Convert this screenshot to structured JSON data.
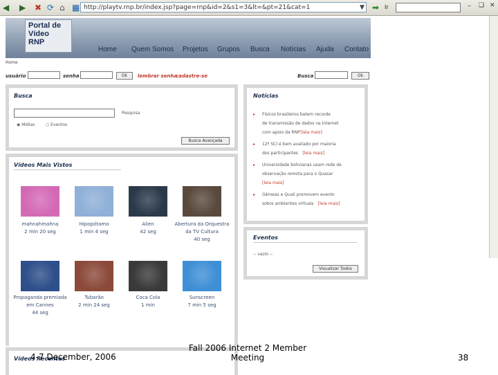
{
  "browser": {
    "address": "http://playtv.rnp.br/index.jsp?page=rnp&id=2&s1=3&lt=&pt=21&cat=1",
    "go_label": "Ir"
  },
  "site": {
    "logo": [
      "Portal de",
      "Vídeo",
      "RNP"
    ],
    "nav": [
      "Home",
      "Quem Somos",
      "Projetos",
      "Grupos",
      "Busca",
      "Notícias",
      "Ajuda",
      "Contato"
    ],
    "breadcrumb": "Home"
  },
  "login": {
    "user_label": "usuário",
    "pass_label": "senha",
    "ok_label": "Ok",
    "forgot_label": "lembrar senha",
    "register_label": "cadastre-se",
    "search_label": "Busca",
    "search_ok": "Ok"
  },
  "busca": {
    "title": "Busca",
    "button": "Pesquisa",
    "options": [
      "Mídias",
      "Eventos"
    ],
    "advanced": "Busca Avançada"
  },
  "videos": {
    "title": "Vídeos Mais Vistos",
    "items": [
      {
        "name": "mahnahmahna",
        "duration": "2 min 20 seg",
        "color": "#d46ab5"
      },
      {
        "name": "Hipopótamo",
        "duration": "1 min 4 seg",
        "color": "#8fb0d8"
      },
      {
        "name": "Alien",
        "duration": "42 seg",
        "color": "#2b3a4a"
      },
      {
        "name": "Abertura da Orquestra da TV Cultura",
        "duration": "40 seg",
        "color": "#5a4a3e"
      },
      {
        "name": "Propaganda premiada em Cannes",
        "duration": "44 seg",
        "color": "#2e4f8a"
      },
      {
        "name": "Tubarão",
        "duration": "2 min 24 seg",
        "color": "#8c4a3a"
      },
      {
        "name": "Coca Cola",
        "duration": "1 min",
        "color": "#3a3a3a"
      },
      {
        "name": "Sunscreen",
        "duration": "7 min 5 seg",
        "color": "#3f8fd6"
      }
    ]
  },
  "videos2_title": "Vídeos Recentes",
  "noticias": {
    "title": "Notícias",
    "items": [
      {
        "lines": [
          "Físicos brasileiros batem recorde",
          "de transmissão de dados na Internet",
          "com apoio da RNP"
        ]
      },
      {
        "lines": [
          "12º SCI é bem avaliado por maioria",
          "dos participantes"
        ]
      },
      {
        "lines": [
          "Universidade bolivianas usam rede de",
          "observação remota para o Quasar"
        ]
      },
      {
        "lines": [
          "Gêmeas e Quali promovem evento",
          "sobre ambientes virtuais"
        ]
      }
    ],
    "more_label": "[leia mais]"
  },
  "eventos": {
    "title": "Eventos",
    "empty": "-- vazio --",
    "button": "Visualizar Todos"
  },
  "footer": {
    "date": "4-7 December, 2006",
    "title_line1": "Fall 2006 Internet 2 Member",
    "title_line2": "Meeting",
    "page": "38"
  }
}
